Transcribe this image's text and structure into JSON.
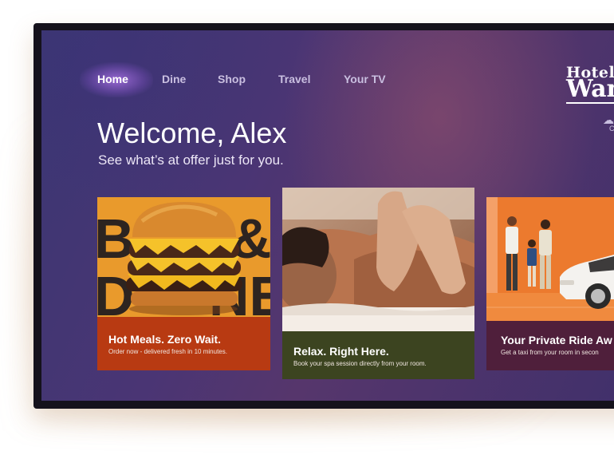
{
  "nav": {
    "items": [
      {
        "label": "Home",
        "active": true
      },
      {
        "label": "Dine"
      },
      {
        "label": "Shop"
      },
      {
        "label": "Travel"
      },
      {
        "label": "Your TV"
      }
    ]
  },
  "brand": {
    "line1": "Hotel",
    "line2": "Wan"
  },
  "weather": {
    "icon": "cloud-rain-icon",
    "text": "C"
  },
  "hero": {
    "title": "Welcome, Alex",
    "subtitle": "See what’s at offer just for you."
  },
  "cards": [
    {
      "title": "Hot Meals. Zero Wait.",
      "description": "Order now - delivered fresh in 10 minutes.",
      "image": "burger-image",
      "image_text": [
        "B",
        "&",
        "D",
        "NE"
      ],
      "caption_color": "#b83a12"
    },
    {
      "title": "Relax. Right Here.",
      "description": "Book your spa session directly from your room.",
      "image": "massage-image",
      "caption_color": "#3c4420"
    },
    {
      "title": "Your Private Ride Aw",
      "description": "Get a taxi from your room in secon",
      "image": "family-car-image",
      "caption_color": "#4f1f3b"
    }
  ],
  "colors": {
    "tv_frame": "#15121c",
    "screen_bg": "#4a3574",
    "nav_active_glow": "#b478f0",
    "nav_inactive": "#c9bfe0",
    "card1_image_bg": "#e99a2c",
    "card3_image_bg": "#ec7a2e"
  }
}
